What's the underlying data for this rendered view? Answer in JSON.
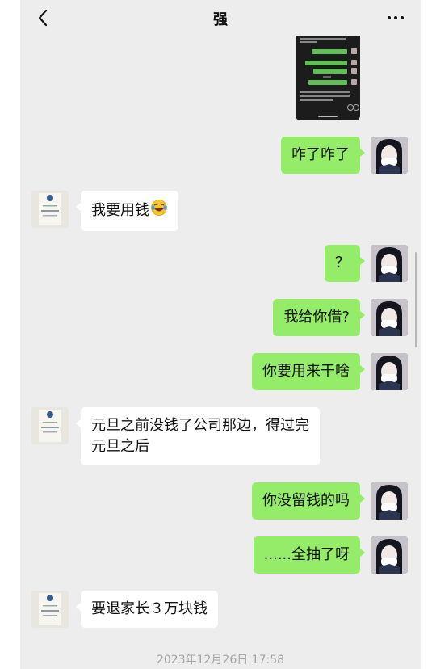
{
  "header": {
    "title": "强"
  },
  "messages": [
    {
      "side": "me",
      "text": "咋了咋了"
    },
    {
      "side": "other",
      "text": "我要用钱",
      "emoji": "laughing-crying-emoji"
    },
    {
      "side": "me",
      "text": "？"
    },
    {
      "side": "me",
      "text": "我给你借?"
    },
    {
      "side": "me",
      "text": "你要用来干啥"
    },
    {
      "side": "other",
      "lines": [
        "元旦之前没钱了公司那边，得过完",
        "元旦之后"
      ]
    },
    {
      "side": "me",
      "text": "你没留钱的吗"
    },
    {
      "side": "me",
      "text": "......全抽了呀"
    },
    {
      "side": "other",
      "text": "要退家长３万块钱"
    }
  ],
  "timestamp": "2023年12月26日 17:58",
  "colors": {
    "background": "#ededed",
    "my_bubble": "#95ec69",
    "other_bubble": "#ffffff"
  },
  "icons": {
    "back": "chevron-left-icon",
    "more": "more-dots-icon"
  }
}
